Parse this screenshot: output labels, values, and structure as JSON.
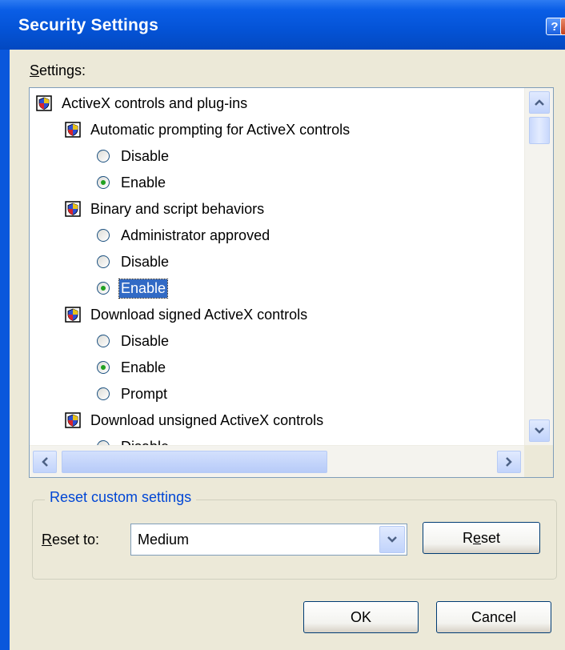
{
  "window": {
    "title": "Security Settings",
    "help_button_label": "?",
    "close_button_label": "X"
  },
  "settings_label": {
    "first": "S",
    "rest": "ettings:"
  },
  "tree": [
    {
      "type": "category",
      "label": "ActiveX controls and plug-ins",
      "level": 0
    },
    {
      "type": "setting",
      "label": "Automatic prompting for ActiveX controls",
      "level": 1
    },
    {
      "type": "option",
      "label": "Disable",
      "level": 2,
      "checked": false
    },
    {
      "type": "option",
      "label": "Enable",
      "level": 2,
      "checked": true
    },
    {
      "type": "setting",
      "label": "Binary and script behaviors",
      "level": 1
    },
    {
      "type": "option",
      "label": "Administrator approved",
      "level": 2,
      "checked": false
    },
    {
      "type": "option",
      "label": "Disable",
      "level": 2,
      "checked": false
    },
    {
      "type": "option",
      "label": "Enable",
      "level": 2,
      "checked": true,
      "selected": true
    },
    {
      "type": "setting",
      "label": "Download signed ActiveX controls",
      "level": 1
    },
    {
      "type": "option",
      "label": "Disable",
      "level": 2,
      "checked": false
    },
    {
      "type": "option",
      "label": "Enable",
      "level": 2,
      "checked": true
    },
    {
      "type": "option",
      "label": "Prompt",
      "level": 2,
      "checked": false
    },
    {
      "type": "setting",
      "label": "Download unsigned ActiveX controls",
      "level": 1
    },
    {
      "type": "option",
      "label": "Disable",
      "level": 2,
      "checked": false
    }
  ],
  "reset_group": {
    "title": "Reset custom settings",
    "reset_to_label": {
      "first": "R",
      "rest": "eset to:"
    },
    "selected_level": "Medium",
    "reset_button": {
      "before": "R",
      "u": "e",
      "after": "set"
    }
  },
  "buttons": {
    "ok": "OK",
    "cancel": "Cancel"
  },
  "icons": {
    "category": "security-setting-icon",
    "setting": "security-setting-icon",
    "scroll_up": "scroll-up-arrow-icon",
    "scroll_down": "scroll-down-arrow-icon",
    "scroll_left": "scroll-left-arrow-icon",
    "scroll_right": "scroll-right-arrow-icon",
    "dropdown": "chevron-down-icon"
  },
  "colors": {
    "titlebar": "#0453d6",
    "dialog_bg": "#ece9d8",
    "selection": "#316ac5",
    "group_title": "#0046d5",
    "radio_dot": "#21a121"
  }
}
